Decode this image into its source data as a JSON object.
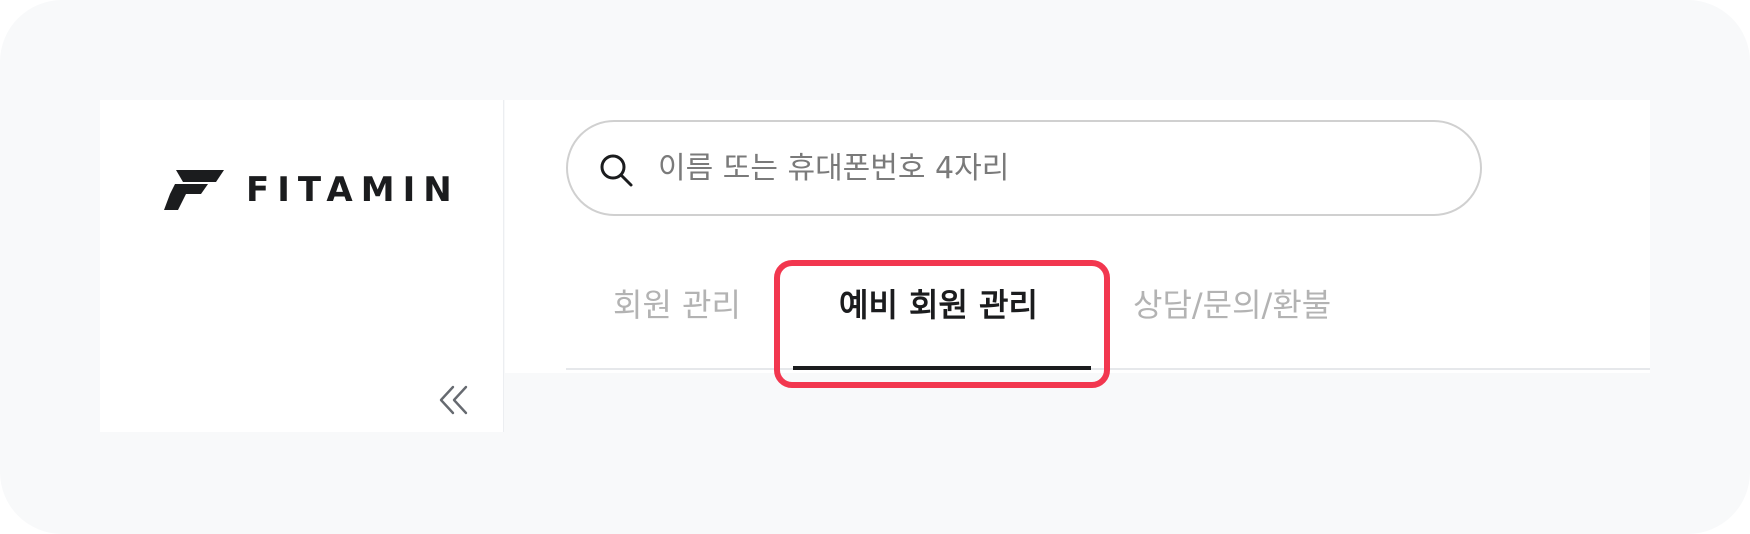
{
  "brand": {
    "name": "FITAMIN"
  },
  "sidebar": {
    "collapse_icon": "double-chevron-left-icon"
  },
  "search": {
    "placeholder": "이름 또는 휴대폰번호 4자리",
    "value": "",
    "icon": "search-icon"
  },
  "tabs": [
    {
      "label": "회원 관리",
      "active": false
    },
    {
      "label": "예비 회원 관리",
      "active": true
    },
    {
      "label": "상담/문의/환불",
      "active": false
    }
  ],
  "colors": {
    "background": "#f8f9fa",
    "active_text": "#1b1c1e",
    "inactive_text": "#b3b3b3",
    "highlight": "#f2374f"
  }
}
